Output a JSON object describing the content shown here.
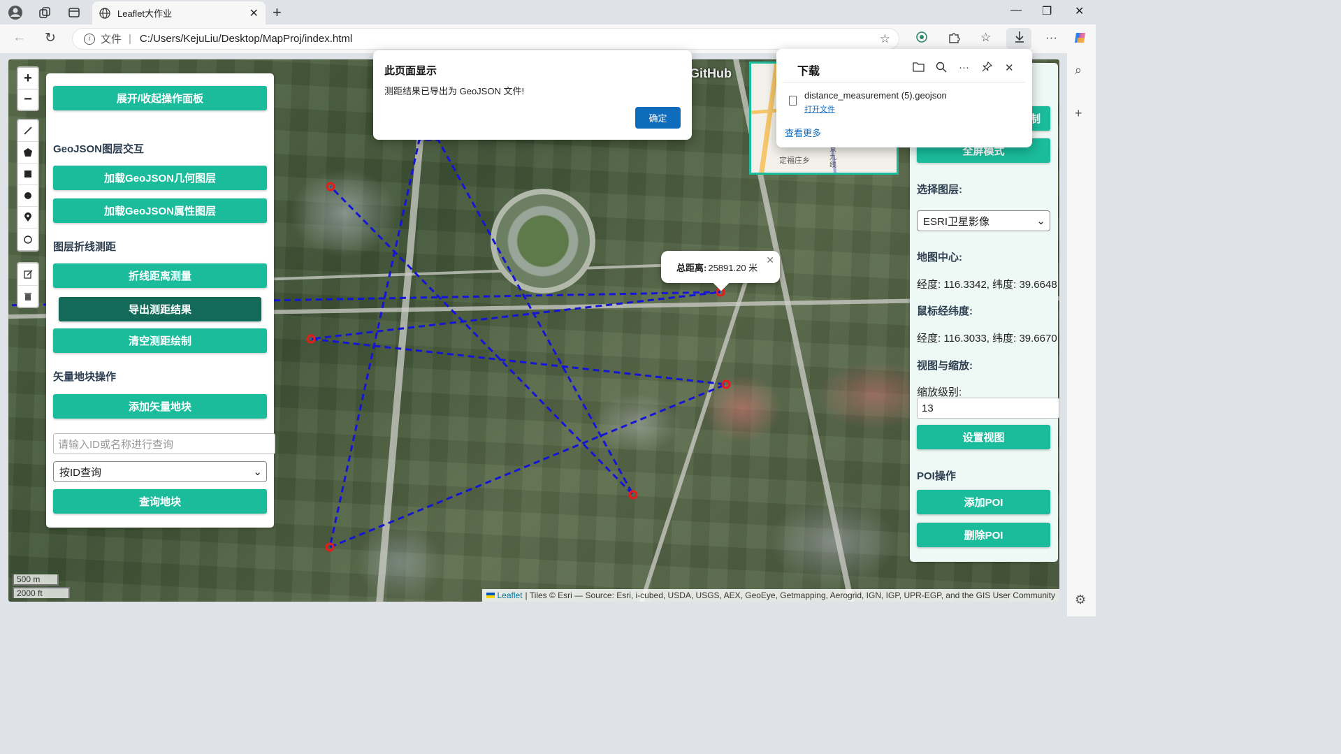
{
  "browser": {
    "tab_title": "Leaflet大作业",
    "address_label": "文件",
    "url": "C:/Users/KejuLiu/Desktop/MapProj/index.html"
  },
  "alert": {
    "title": "此页面显示",
    "message": "测距结果已导出为 GeoJSON 文件!",
    "ok_label": "确定"
  },
  "downloads": {
    "title": "下载",
    "file_name": "distance_measurement (5).geojson",
    "open_file_label": "打开文件",
    "see_more_label": "查看更多"
  },
  "map": {
    "zoom_in": "+",
    "zoom_out": "−",
    "github_label": "GitHub",
    "popup_label": "总距离:",
    "popup_value": "25891.20 米",
    "scale_metric": "500 m",
    "scale_imperial": "2000 ft",
    "attribution_leaflet": "Leaflet",
    "attribution_text": "| Tiles © Esri — Source: Esri, i-cubed, USDA, USGS, AEX, GeoEye, Getmapping, Aerogrid, IGN, IGP, UPR-EGP, and the GIS User Community",
    "minimap_labels": [
      "定福庄乡",
      "京九线"
    ],
    "route_color": "#1515d6",
    "vertex_color": "#e81b1b"
  },
  "left_panel": {
    "toggle_button": "展开/收起操作面板",
    "geojson_section": "GeoJSON图层交互",
    "load_geometry_button": "加载GeoJSON几何图层",
    "load_attribute_button": "加载GeoJSON属性图层",
    "measure_section": "图层折线测距",
    "polyline_measure_button": "折线距离测量",
    "export_button": "导出测距结果",
    "clear_button": "清空测距绘制",
    "vector_section": "矢量地块操作",
    "add_parcel_button": "添加矢量地块",
    "query_placeholder": "请输入ID或名称进行查询",
    "query_mode": "按ID查询",
    "query_button": "查询地块"
  },
  "right_panel": {
    "hidden_button_fragment": "制",
    "fullscreen_button": "全屏模式",
    "layer_label": "选择图层:",
    "layer_value": "ESRI卫星影像",
    "center_label": "地图中心:",
    "center_value": "经度: 116.3342, 纬度: 39.6648",
    "mouse_label": "鼠标经纬度:",
    "mouse_value": "经度: 116.3033, 纬度: 39.6670",
    "view_section": "视图与缩放:",
    "zoom_label": "缩放级别:",
    "zoom_value": "13",
    "set_view_button": "设置视图",
    "poi_section": "POI操作",
    "add_poi_button": "添加POI",
    "delete_poi_button": "删除POI"
  }
}
